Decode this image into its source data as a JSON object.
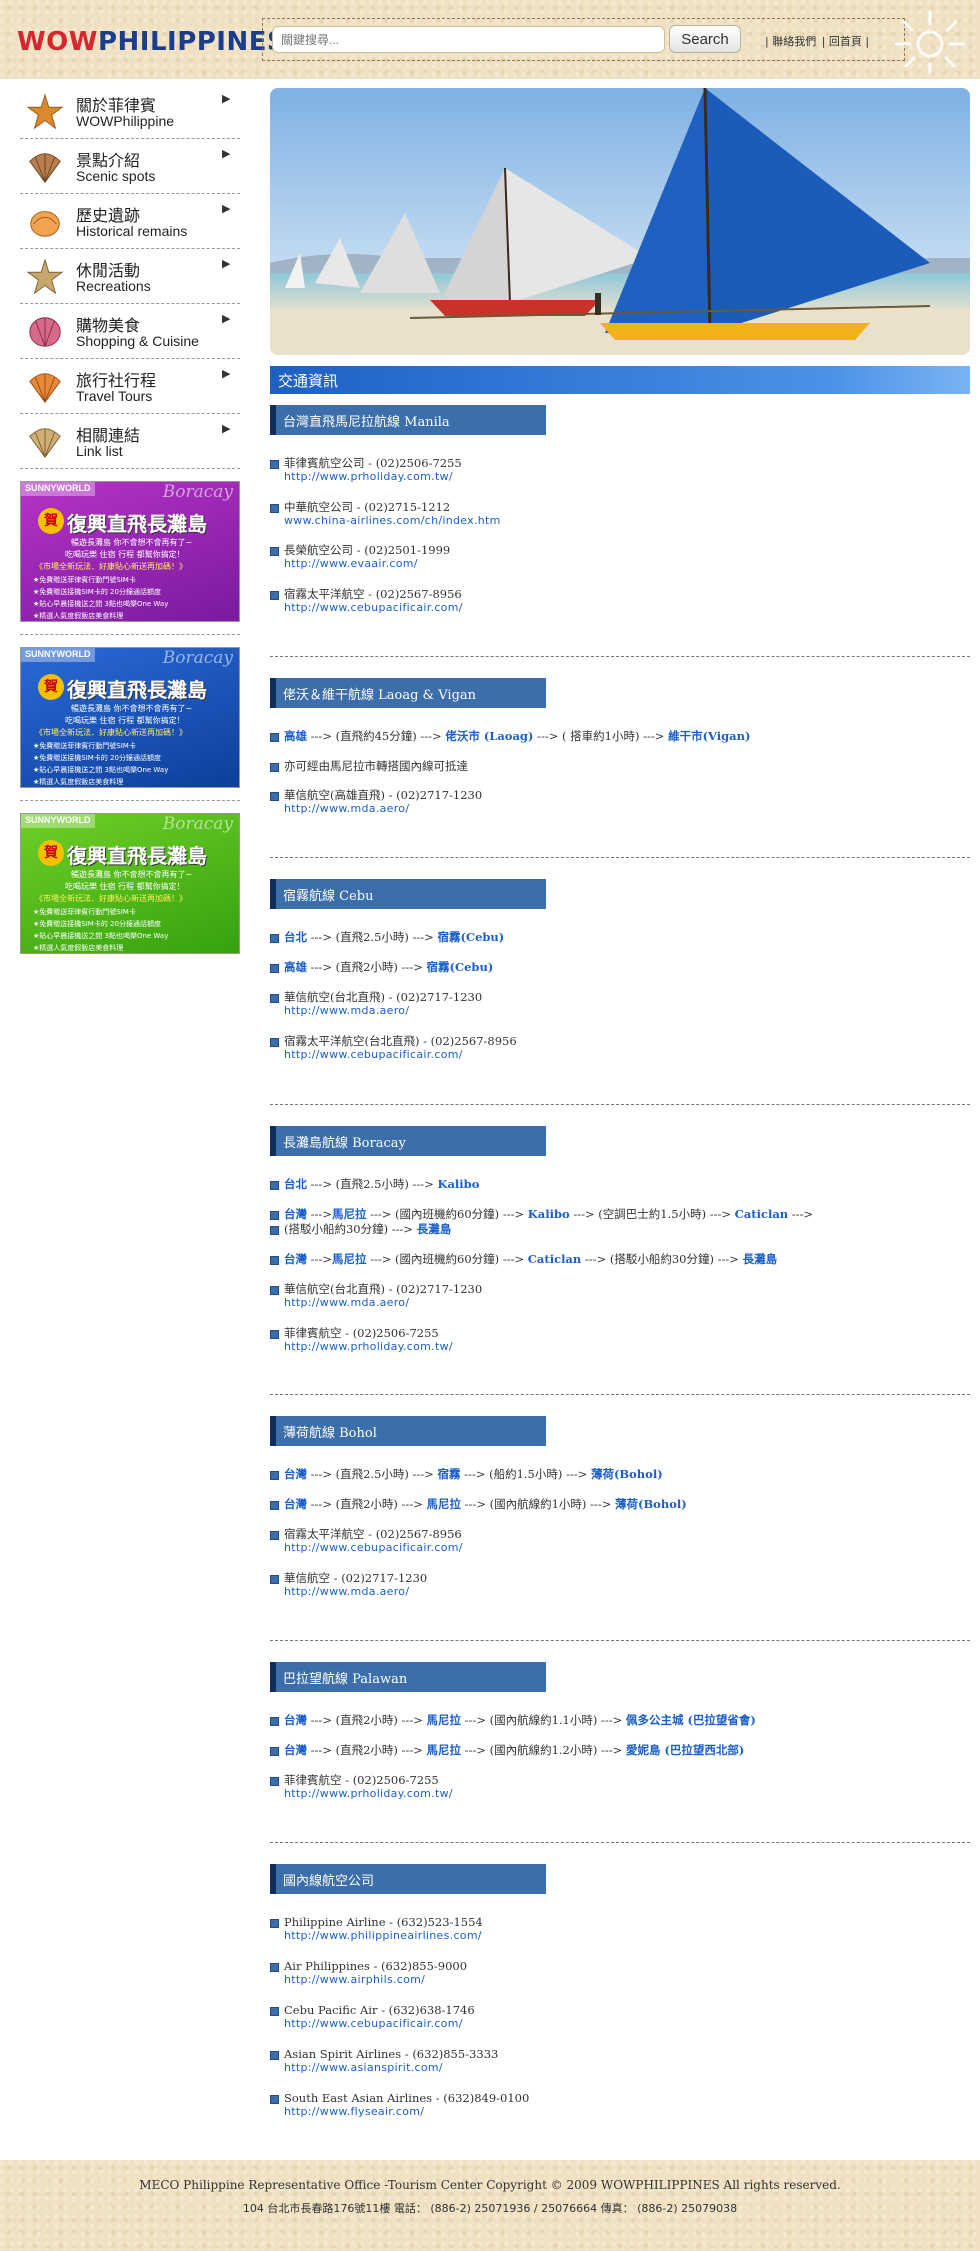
{
  "header": {
    "logo_part1": "WOW",
    "logo_part2": "PHILIPPINES",
    "search_placeholder": "關鍵搜尋...",
    "search_button": "Search",
    "link_contact": "| 聯絡我們",
    "link_home": "| 回首頁 |"
  },
  "sidebar": {
    "items": [
      {
        "zh": "關於菲律賓",
        "en": "WOWPhilippine",
        "icon": "starfish-icon"
      },
      {
        "zh": "景點介紹",
        "en": "Scenic spots",
        "icon": "scallop-shell-icon"
      },
      {
        "zh": "歷史遺跡",
        "en": "Historical remains",
        "icon": "conch-shell-icon"
      },
      {
        "zh": "休閒活動",
        "en": "Recreations",
        "icon": "starfish-icon"
      },
      {
        "zh": "購物美食",
        "en": "Shopping & Cuisine",
        "icon": "clam-shell-icon"
      },
      {
        "zh": "旅行社行程",
        "en": "Travel Tours",
        "icon": "scallop-shell-icon"
      },
      {
        "zh": "相關連結",
        "en": "Link list",
        "icon": "scallop-shell-icon"
      }
    ],
    "arrow": "▶"
  },
  "promos": [
    {
      "brand": "SUNNYWORLD",
      "script": "Boracay",
      "badge": "賀",
      "headline": "復興直飛長灘島",
      "line1": "暢遊長灘島 你不會想不會再有了~",
      "line2": "吃喝玩樂 住宿 行程 都幫你搞定！",
      "line3": "《市場全新玩法．好康貼心新送再加碼！》",
      "bullets": [
        "★免費贈送菲律賓行動門號SIM卡",
        "★免費贈送接機SIM卡的 20分鐘通話額度",
        "★貼心早晨接機送之間 3點也喝樂One Way",
        "★精選人氣度假飯店美食料理"
      ]
    },
    {
      "brand": "SUNNYWORLD",
      "script": "Boracay",
      "badge": "賀",
      "headline": "復興直飛長灘島",
      "line1": "暢遊長灘島 你不會想不會再有了~",
      "line2": "吃喝玩樂 住宿 行程 都幫你搞定！",
      "line3": "《市場全新玩法．好康貼心新送再加碼！》",
      "bullets": [
        "★免費贈送菲律賓行動門號SIM卡",
        "★免費贈送接機SIM卡的 20分鐘通話額度",
        "★貼心早晨接機送之間 3點也喝樂One Way",
        "★精選人氣度假飯店美食料理"
      ]
    },
    {
      "brand": "SUNNYWORLD",
      "script": "Boracay",
      "badge": "賀",
      "headline": "復興直飛長灘島",
      "line1": "暢遊長灘島 你不會想不會再有了~",
      "line2": "吃喝玩樂 住宿 行程 都幫你搞定！",
      "line3": "《市場全新玩法．好康貼心新送再加碼！》",
      "bullets": [
        "★免費贈送菲律賓行動門號SIM卡",
        "★免費贈送接機SIM卡的 20分鐘通話額度",
        "★貼心早晨接機送之間 3點也喝樂One Way",
        "★精選人氣度假飯店美食料理"
      ]
    }
  ],
  "main": {
    "section_title": "交通資訊",
    "manila": {
      "title": "台灣直飛馬尼拉航線 Manila",
      "e1": "菲律賓航空公司 - (02)2506-7255",
      "u1": "http://www.prholiday.com.tw/",
      "e2": "中華航空公司 - (02)2715-1212",
      "u2": "www.china-airlines.com/ch/index.htm",
      "e3": "長榮航空公司 - (02)2501-1999",
      "u3": "http://www.evaair.com/",
      "e4": "宿霧太平洋航空 - (02)2567-8956",
      "u4": "http://www.cebupacificair.com/"
    },
    "laoag": {
      "title": "佬沃＆維干航線 Laoag & Vigan",
      "r1_a": "高雄",
      "r1_b": " ---> (直飛約45分鐘) ---> ",
      "r1_c": "佬沃市 (Laoag)",
      "r1_d": " ---> ( 搭車約1小時) ---> ",
      "r1_e": "維干市(Vigan)",
      "r2": "亦可經由馬尼拉市轉搭國內線可抵達",
      "e3": "華信航空(高雄直飛) - (02)2717-1230",
      "u3": "http://www.mda.aero/"
    },
    "cebu": {
      "title": "宿霧航線 Cebu",
      "r1_a": "台北",
      "r1_b": " ---> (直飛2.5小時) ---> ",
      "r1_c": "宿霧(Cebu)",
      "r2_a": "高雄",
      "r2_b": " ---> (直飛2小時) ---> ",
      "r2_c": "宿霧(Cebu)",
      "e3": "華信航空(台北直飛) - (02)2717-1230",
      "u3": "http://www.mda.aero/",
      "e4": "宿霧太平洋航空(台北直飛) - (02)2567-8956",
      "u4": "http://www.cebupacificair.com/"
    },
    "boracay": {
      "title": "長灘島航線 Boracay",
      "r1_a": "台北",
      "r1_b": " ---> (直飛2.5小時) ---> ",
      "r1_c": "Kalibo",
      "r2_a": "台灣",
      "r2_b": " --->",
      "r2_c": "馬尼拉",
      "r2_d": " ---> (國內班機約60分鐘) ---> ",
      "r2_e": "Kalibo",
      "r2_f": " ---> (空調巴士約1.5小時) ---> ",
      "r2_g": "Caticlan",
      "r2_h": " --->",
      "r2_line2_a": "(搭駁小船約30分鐘) ---> ",
      "r2_line2_b": "長灘島",
      "r3_a": "台灣",
      "r3_b": " --->",
      "r3_c": "馬尼拉",
      "r3_d": " ---> (國內班機約60分鐘) ---> ",
      "r3_e": "Caticlan",
      "r3_f": " ---> (搭駁小船約30分鐘) ---> ",
      "r3_g": "長灘島",
      "e4": "華信航空(台北直飛) - (02)2717-1230",
      "u4": "http://www.mda.aero/",
      "e5": "菲律賓航空 - (02)2506-7255",
      "u5": "http://www.prholiday.com.tw/"
    },
    "bohol": {
      "title": "薄荷航線 Bohol",
      "r1_a": "台灣",
      "r1_b": " ---> (直飛2.5小時) ---> ",
      "r1_c": "宿霧",
      "r1_d": " ---> (船約1.5小時) ---> ",
      "r1_e": "薄荷(Bohol)",
      "r2_a": "台灣",
      "r2_b": " ---> (直飛2小時) ---> ",
      "r2_c": "馬尼拉",
      "r2_d": " ---> (國內航線約1小時) ---> ",
      "r2_e": "薄荷(Bohol)",
      "e3": "宿霧太平洋航空 - (02)2567-8956",
      "u3": "http://www.cebupacificair.com/",
      "e4": "華信航空 - (02)2717-1230",
      "u4": "http://www.mda.aero/"
    },
    "palawan": {
      "title": "巴拉望航線 Palawan",
      "r1_a": "台灣",
      "r1_b": " ---> (直飛2小時) ---> ",
      "r1_c": "馬尼拉",
      "r1_d": " ---> (國內航線約1.1小時) ---> ",
      "r1_e": "佩多公主城 (巴拉望省會)",
      "r2_a": "台灣",
      "r2_b": " ---> (直飛2小時) ---> ",
      "r2_c": "馬尼拉",
      "r2_d": " ---> (國內航線約1.2小時) ---> ",
      "r2_e": "愛妮島 (巴拉望西北部)",
      "e3": "菲律賓航空 - (02)2506-7255",
      "u3": "http://www.prholiday.com.tw/"
    },
    "domestic": {
      "title": "國內線航空公司",
      "e1": "Philippine Airline - (632)523-1554",
      "u1": "http://www.philippineairlines.com/",
      "e2": "Air Philippines - (632)855-9000",
      "u2": "http://www.airphils.com/",
      "e3": "Cebu Pacific Air - (632)638-1746",
      "u3": "http://www.cebupacificair.com/",
      "e4": "Asian Spirit Airlines - (632)855-3333",
      "u4": "http://www.asianspirit.com/",
      "e5": "South East Asian Airlines - (632)849-0100",
      "u5": "http://www.flyseair.com/"
    }
  },
  "footer": {
    "line1": "MECO Philippine Representative Office -Tourism Center     Copyright © 2009 WOWPHILIPPINES All rights reserved.",
    "line2": "104 台北市長春路176號11樓        電話： (886-2) 25071936 / 25076664        傳真： (886-2) 25079038"
  },
  "colors": {
    "accent_blue": "#3b6eaa",
    "link_blue": "#1b5fcc",
    "sand": "#efe1c2",
    "logo_red": "#d7262f",
    "logo_blue": "#1a3e8c"
  }
}
